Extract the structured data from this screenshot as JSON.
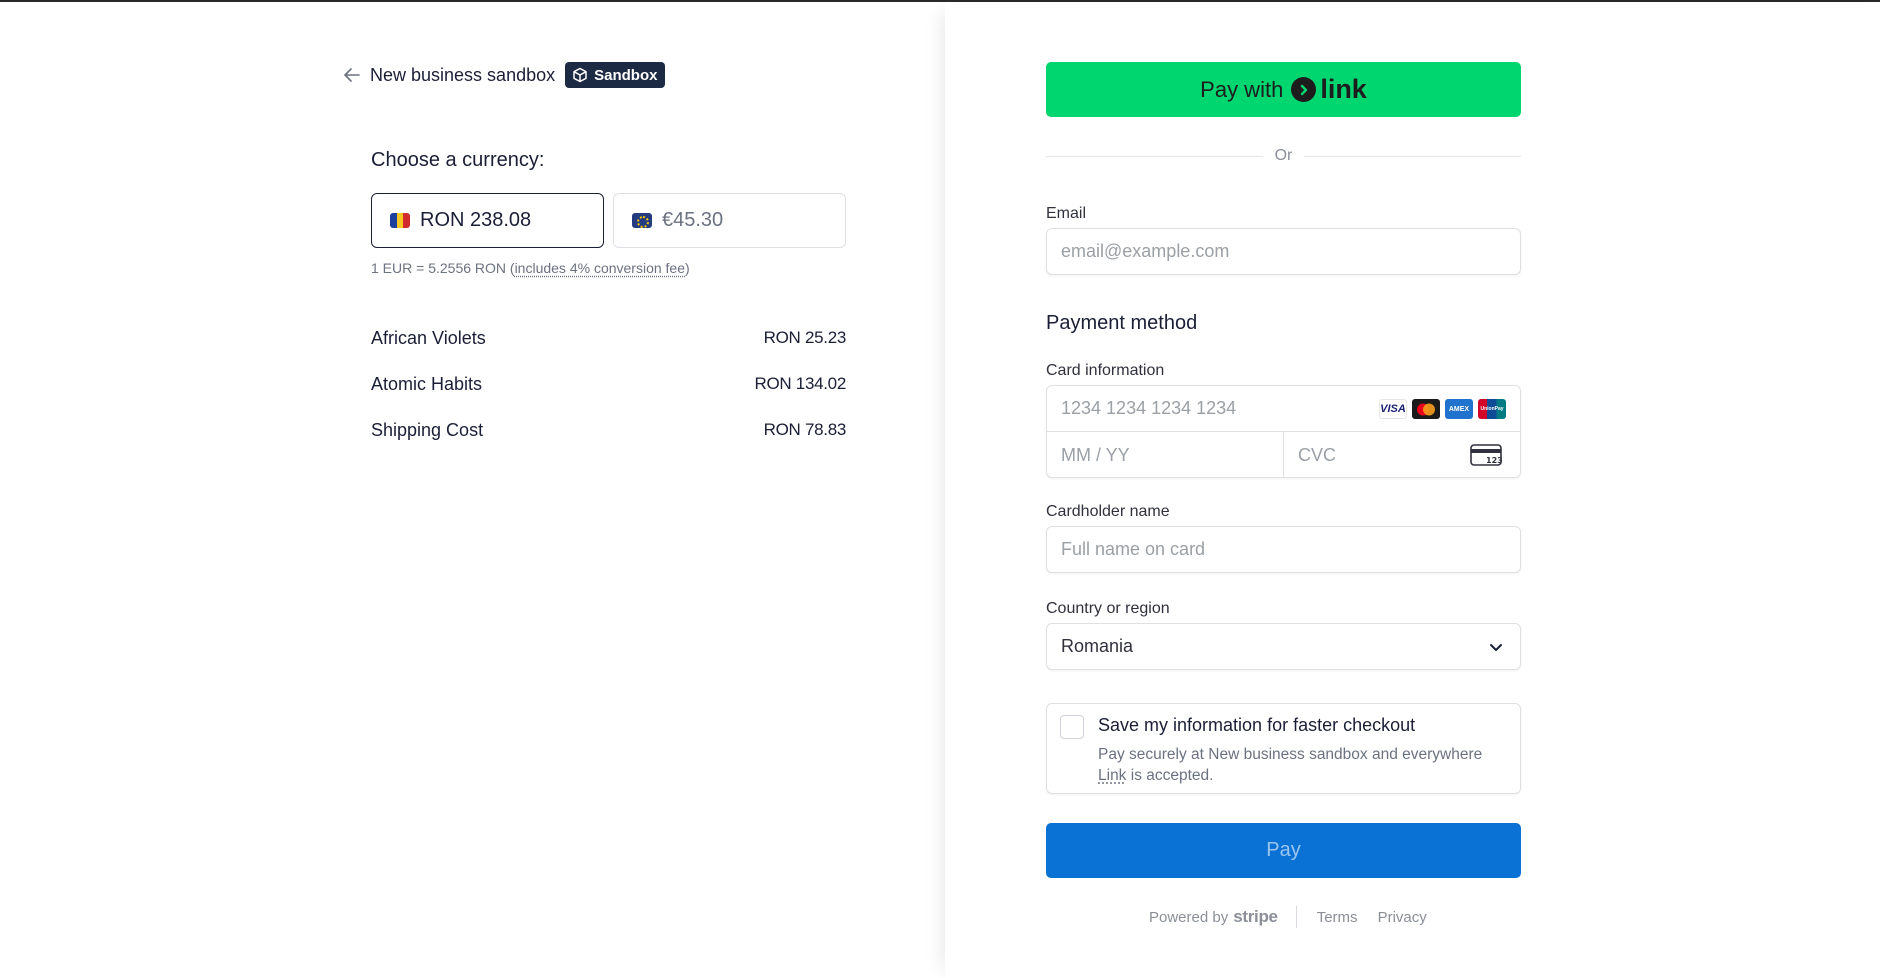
{
  "header": {
    "business_name": "New business sandbox",
    "badge_label": "Sandbox"
  },
  "currency": {
    "title": "Choose a currency:",
    "options": [
      {
        "label": "RON 238.08",
        "flag": "romania-flag",
        "selected": true
      },
      {
        "label": "€45.30",
        "flag": "eu-flag",
        "selected": false
      }
    ],
    "rate_prefix": "1 EUR = 5.2556 RON (",
    "rate_fee": "includes 4% conversion fee",
    "rate_suffix": ")"
  },
  "items": [
    {
      "name": "African Violets",
      "price": "RON 25.23"
    },
    {
      "name": "Atomic Habits",
      "price": "RON 134.02"
    },
    {
      "name": "Shipping Cost",
      "price": "RON 78.83"
    }
  ],
  "link_button": {
    "prefix": "Pay with",
    "brand": "link"
  },
  "divider": "Or",
  "email": {
    "label": "Email",
    "placeholder": "email@example.com"
  },
  "payment": {
    "title": "Payment method",
    "card_label": "Card information",
    "card_number_placeholder": "1234 1234 1234 1234",
    "expiry_placeholder": "MM / YY",
    "cvc_placeholder": "CVC",
    "brands": [
      "VISA",
      "mastercard-icon",
      "AMEX",
      "UnionPay"
    ],
    "cardholder_label": "Cardholder name",
    "cardholder_placeholder": "Full name on card",
    "country_label": "Country or region",
    "country_value": "Romania"
  },
  "save_info": {
    "title": "Save my information for faster checkout",
    "desc_prefix": "Pay securely at New business sandbox and everywhere ",
    "desc_link": "Link",
    "desc_suffix": " is accepted."
  },
  "pay_button": "Pay",
  "footer": {
    "powered_by": "Powered by",
    "brand": "stripe",
    "terms": "Terms",
    "privacy": "Privacy"
  },
  "colors": {
    "link_green": "#00d66f",
    "pay_blue": "#0a72d4",
    "badge_navy": "#1c2a44"
  }
}
